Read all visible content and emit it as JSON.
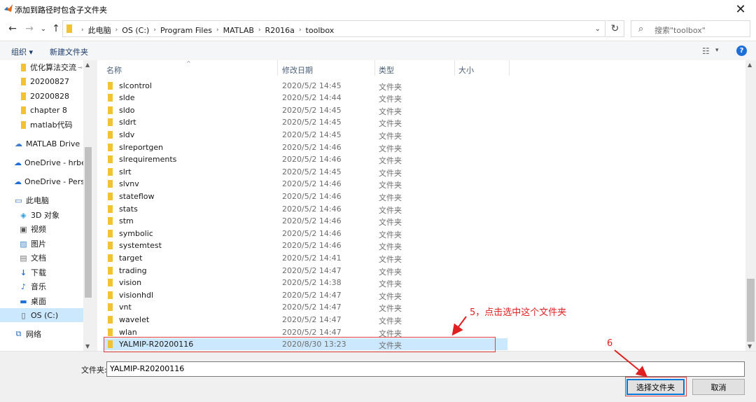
{
  "window": {
    "title": "添加到路径时包含子文件夹",
    "close_glyph": "✕"
  },
  "nav_buttons": {
    "back": "←",
    "forward": "→",
    "history": "⌄",
    "up": "↑"
  },
  "address": {
    "crumbs": [
      "此电脑",
      "OS (C:)",
      "Program Files",
      "MATLAB",
      "R2016a",
      "toolbox"
    ],
    "separator": "›",
    "dropdown": "⌄",
    "refresh": "↻"
  },
  "search": {
    "icon": "search-icon",
    "placeholder": "搜索\"toolbox\"",
    "glyph": "⌕"
  },
  "toolbar": {
    "organize": "组织 ▾",
    "new_folder": "新建文件夹",
    "view_icon": "☷",
    "view_drop": "▾",
    "help": "?"
  },
  "sidebar": {
    "items": [
      {
        "label": "优化算法交流",
        "icon": "folder-icon",
        "pinned": true
      },
      {
        "label": "20200827",
        "icon": "folder-icon"
      },
      {
        "label": "20200828",
        "icon": "folder-icon"
      },
      {
        "label": "chapter 8",
        "icon": "folder-icon"
      },
      {
        "label": "matlab代码",
        "icon": "folder-icon"
      },
      {
        "label": "MATLAB Drive",
        "icon": "cloud-icon",
        "glyph": "☁"
      },
      {
        "label": "OneDrive - hrbeu",
        "icon": "cloud-icon",
        "glyph": "☁"
      },
      {
        "label": "OneDrive - Perso",
        "icon": "cloud-icon",
        "glyph": "☁"
      },
      {
        "label": "此电脑",
        "icon": "computer-icon",
        "glyph": "▭"
      },
      {
        "label": "3D 对象",
        "icon": "cube-icon",
        "glyph": "◈"
      },
      {
        "label": "视频",
        "icon": "video-icon",
        "glyph": "▣"
      },
      {
        "label": "图片",
        "icon": "picture-icon",
        "glyph": "▨"
      },
      {
        "label": "文档",
        "icon": "document-icon",
        "glyph": "▤"
      },
      {
        "label": "下载",
        "icon": "download-icon",
        "glyph": "↓"
      },
      {
        "label": "音乐",
        "icon": "music-icon",
        "glyph": "♪"
      },
      {
        "label": "桌面",
        "icon": "desktop-icon",
        "glyph": "▬"
      },
      {
        "label": "OS (C:)",
        "icon": "drive-icon",
        "glyph": "▯",
        "selected": true
      },
      {
        "label": "网络",
        "icon": "network-icon",
        "glyph": "⧉"
      }
    ],
    "pin_glyph": "📌"
  },
  "columns": {
    "name": "名称",
    "date": "修改日期",
    "type": "类型",
    "size": "大小"
  },
  "files": [
    {
      "name": "slcontrol",
      "date": "2020/5/2 14:45",
      "type": "文件夹"
    },
    {
      "name": "slde",
      "date": "2020/5/2 14:44",
      "type": "文件夹"
    },
    {
      "name": "sldo",
      "date": "2020/5/2 14:45",
      "type": "文件夹"
    },
    {
      "name": "sldrt",
      "date": "2020/5/2 14:45",
      "type": "文件夹"
    },
    {
      "name": "sldv",
      "date": "2020/5/2 14:45",
      "type": "文件夹"
    },
    {
      "name": "slreportgen",
      "date": "2020/5/2 14:46",
      "type": "文件夹"
    },
    {
      "name": "slrequirements",
      "date": "2020/5/2 14:46",
      "type": "文件夹"
    },
    {
      "name": "slrt",
      "date": "2020/5/2 14:45",
      "type": "文件夹"
    },
    {
      "name": "slvnv",
      "date": "2020/5/2 14:46",
      "type": "文件夹"
    },
    {
      "name": "stateflow",
      "date": "2020/5/2 14:46",
      "type": "文件夹"
    },
    {
      "name": "stats",
      "date": "2020/5/2 14:46",
      "type": "文件夹"
    },
    {
      "name": "stm",
      "date": "2020/5/2 14:46",
      "type": "文件夹"
    },
    {
      "name": "symbolic",
      "date": "2020/5/2 14:46",
      "type": "文件夹"
    },
    {
      "name": "systemtest",
      "date": "2020/5/2 14:46",
      "type": "文件夹"
    },
    {
      "name": "target",
      "date": "2020/5/2 14:41",
      "type": "文件夹"
    },
    {
      "name": "trading",
      "date": "2020/5/2 14:47",
      "type": "文件夹"
    },
    {
      "name": "vision",
      "date": "2020/5/2 14:38",
      "type": "文件夹"
    },
    {
      "name": "visionhdl",
      "date": "2020/5/2 14:47",
      "type": "文件夹"
    },
    {
      "name": "vnt",
      "date": "2020/5/2 14:47",
      "type": "文件夹"
    },
    {
      "name": "wavelet",
      "date": "2020/5/2 14:47",
      "type": "文件夹"
    },
    {
      "name": "wlan",
      "date": "2020/5/2 14:47",
      "type": "文件夹"
    },
    {
      "name": "YALMIP-R20200116",
      "date": "2020/8/30 13:23",
      "type": "文件夹",
      "selected": true
    }
  ],
  "footer": {
    "folder_label": "文件夹:",
    "folder_value": "YALMIP-R20200116",
    "select_button": "选择文件夹",
    "cancel_button": "取消"
  },
  "annotations": {
    "step5": "5，点击选中这个文件夹",
    "step6": "6",
    "color": "#e02020"
  },
  "colors": {
    "selection": "#cce8ff",
    "folder": "#f1c232",
    "accent": "#0078d7"
  }
}
